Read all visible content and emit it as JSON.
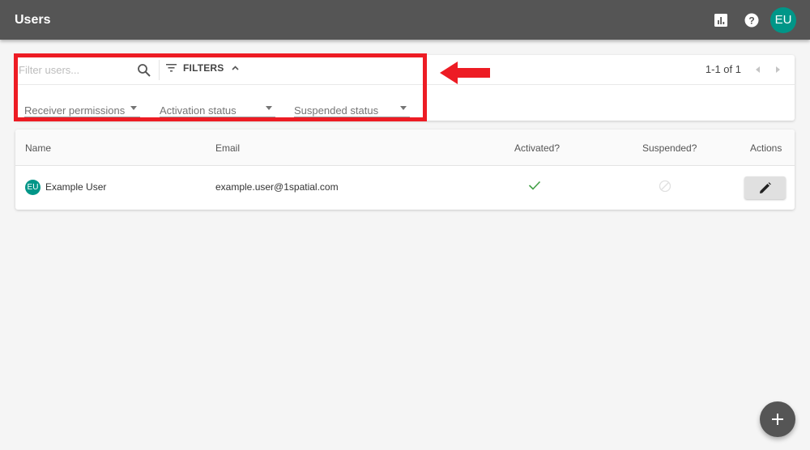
{
  "appbar": {
    "title": "Users",
    "icons": [
      "bar-chart-icon",
      "help-icon"
    ],
    "user_initials": "EU"
  },
  "filters": {
    "search": {
      "value": "",
      "placeholder": "Filter users..."
    },
    "filters_button_label": "FILTERS",
    "filters_expanded": true,
    "selects": [
      {
        "label": "Receiver permissions",
        "value": ""
      },
      {
        "label": "Activation status",
        "value": ""
      },
      {
        "label": "Suspended status",
        "value": ""
      }
    ],
    "pagination": "1-1 of 1"
  },
  "annotation": {
    "highlight_color": "#ed1c24",
    "arrow_color": "#ed1c24"
  },
  "table": {
    "columns": [
      "Name",
      "Email",
      "Activated?",
      "Suspended?",
      "Actions"
    ],
    "rows": [
      {
        "initials": "EU",
        "name": "Example User",
        "email": "example.user@1spatial.com",
        "activated": true,
        "suspended": false,
        "action_icon": "edit-icon"
      }
    ]
  },
  "fab": {
    "icon": "add-icon"
  },
  "colors": {
    "appbar": "#555555",
    "accent": "#009688",
    "check": "#43a047"
  }
}
